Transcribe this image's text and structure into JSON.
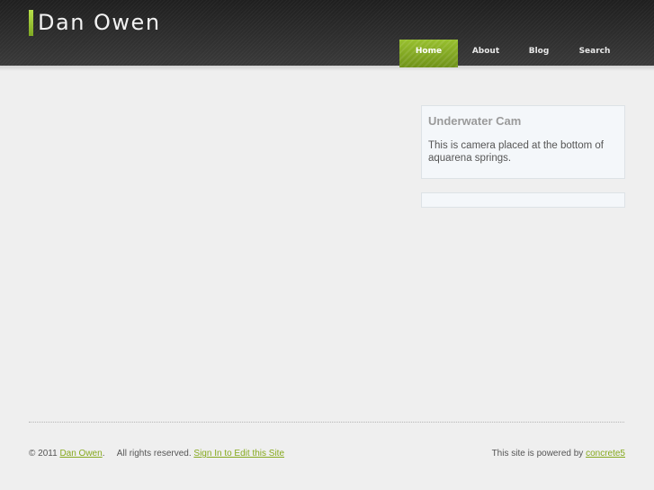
{
  "header": {
    "site_title": "Dan Owen",
    "nav": [
      {
        "label": "Home",
        "active": true
      },
      {
        "label": "About",
        "active": false
      },
      {
        "label": "Blog",
        "active": false
      },
      {
        "label": "Search",
        "active": false
      }
    ]
  },
  "sidebar": {
    "blocks": [
      {
        "title": "Underwater Cam",
        "body": "This is camera placed at the bottom of aquarena springs."
      }
    ]
  },
  "footer": {
    "copyright": "© 2011",
    "owner_link": "Dan Owen",
    "rights_text": ".     All rights reserved.",
    "signin_link": "Sign In to Edit this Site",
    "powered_text": "This site is powered by",
    "powered_link": "concrete5"
  },
  "colors": {
    "accent": "#86a91e",
    "header_bg": "#2c2c2c",
    "page_bg": "#efefef"
  }
}
